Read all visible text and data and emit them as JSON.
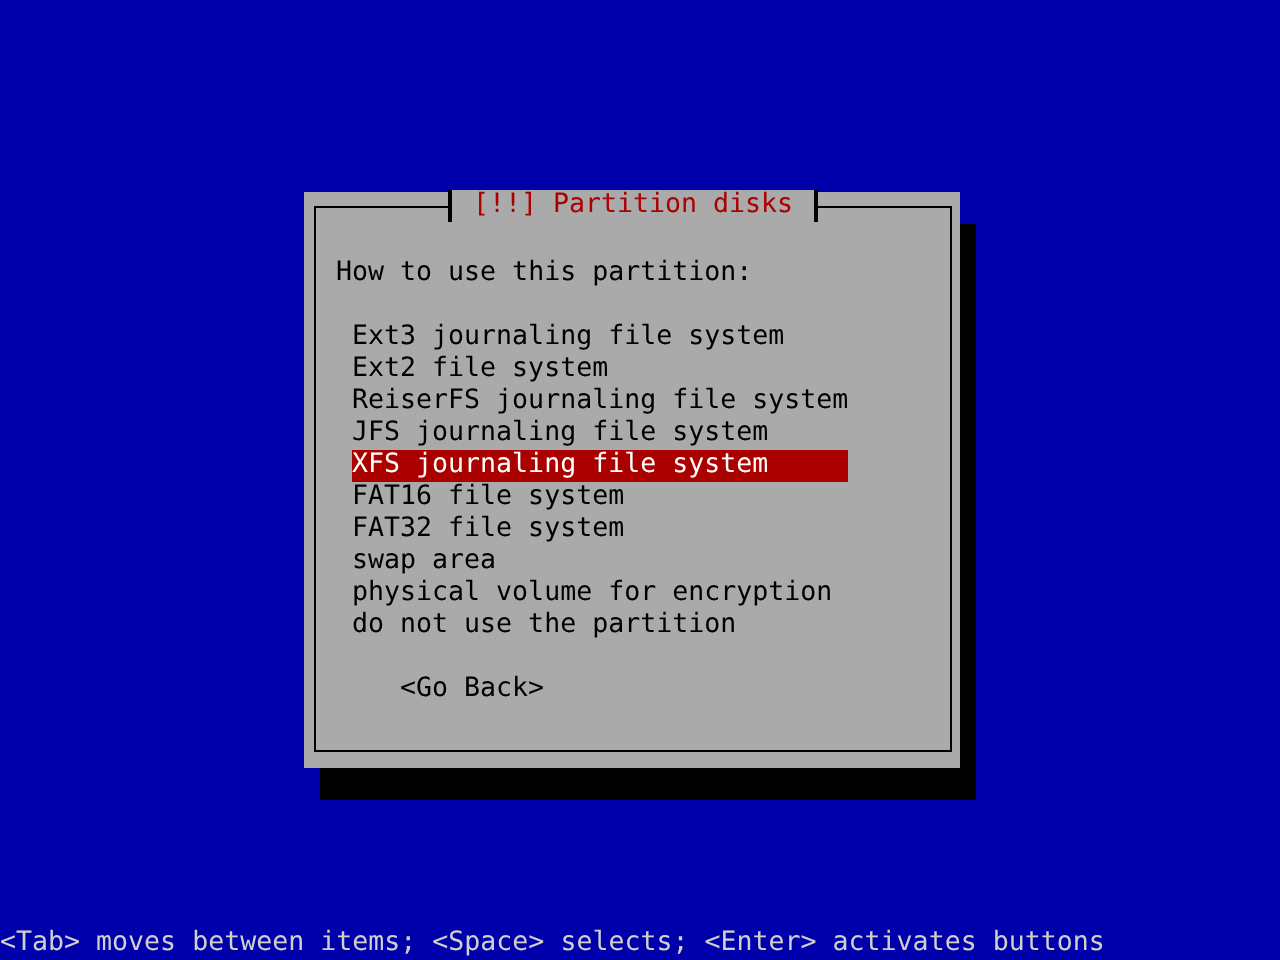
{
  "dialog": {
    "title": "[!!] Partition disks",
    "prompt": "How to use this partition:",
    "options": [
      {
        "label": "Ext3 journaling file system",
        "selected": false
      },
      {
        "label": "Ext2 file system",
        "selected": false
      },
      {
        "label": "ReiserFS journaling file system",
        "selected": false
      },
      {
        "label": "JFS journaling file system",
        "selected": false
      },
      {
        "label": "XFS journaling file system",
        "selected": true
      },
      {
        "label": "FAT16 file system",
        "selected": false
      },
      {
        "label": "FAT32 file system",
        "selected": false
      },
      {
        "label": "swap area",
        "selected": false
      },
      {
        "label": "physical volume for encryption",
        "selected": false
      },
      {
        "label": "do not use the partition",
        "selected": false
      }
    ],
    "buttons": [
      "<Go Back>"
    ]
  },
  "status_bar": "<Tab> moves between items; <Space> selects; <Enter> activates buttons"
}
